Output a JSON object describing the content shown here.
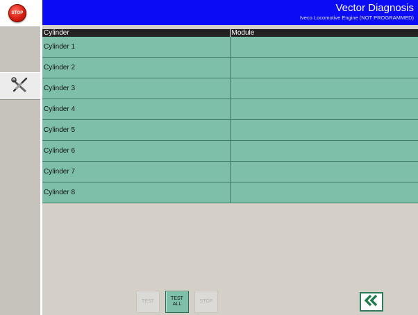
{
  "sidebar": {
    "stop_label": "STOP"
  },
  "header": {
    "title": "Vector Diagnosis",
    "subtitle": "Iveco Locomotive Engine (NOT PROGRAMMED)",
    "bg_color": "#0b0bf5"
  },
  "table": {
    "columns": [
      "Cylinder",
      "Module"
    ],
    "rows": [
      [
        "Cylinder 1",
        ""
      ],
      [
        "Cylinder 2",
        ""
      ],
      [
        "Cylinder 3",
        ""
      ],
      [
        "Cylinder 4",
        ""
      ],
      [
        "Cylinder 5",
        ""
      ],
      [
        "Cylinder 6",
        ""
      ],
      [
        "Cylinder 7",
        ""
      ],
      [
        "Cylinder 8",
        ""
      ]
    ],
    "row_color": "#7ebfa9"
  },
  "footer": {
    "test_label": "TEST",
    "test_all_label": "TEST ALL",
    "stop_label": "STOP",
    "back_icon": "double-chevron-left-icon"
  }
}
